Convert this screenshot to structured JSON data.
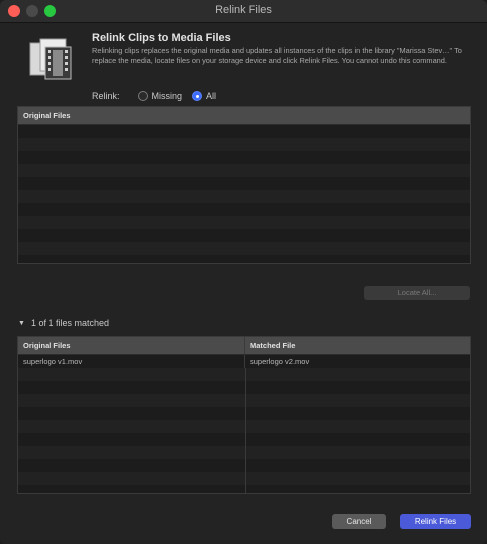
{
  "window": {
    "title": "Relink Files"
  },
  "header": {
    "heading": "Relink Clips to Media Files",
    "description": "Relinking clips replaces the original media and updates all instances of the clips in the library \"Marissa Stev…\" To replace the media, locate files on your storage device and click Relink Files. You cannot undo this command.",
    "relink_label": "Relink:",
    "options": [
      "Missing",
      "All"
    ],
    "selected_option": "All",
    "icon": "documents-icon"
  },
  "original_table": {
    "header": "Original Files",
    "rows": []
  },
  "locate_all_label": "Locate All...",
  "matched_section": {
    "summary": "1 of 1 files matched",
    "columns": [
      "Original Files",
      "Matched File"
    ],
    "rows": [
      {
        "original": "superlogo v1.mov",
        "matched": "superlogo v2.mov"
      }
    ]
  },
  "buttons": {
    "cancel": "Cancel",
    "relink": "Relink Files"
  },
  "colors": {
    "accent": "#4a5ad8",
    "close": "#ff5f57",
    "maximize": "#28c840"
  }
}
